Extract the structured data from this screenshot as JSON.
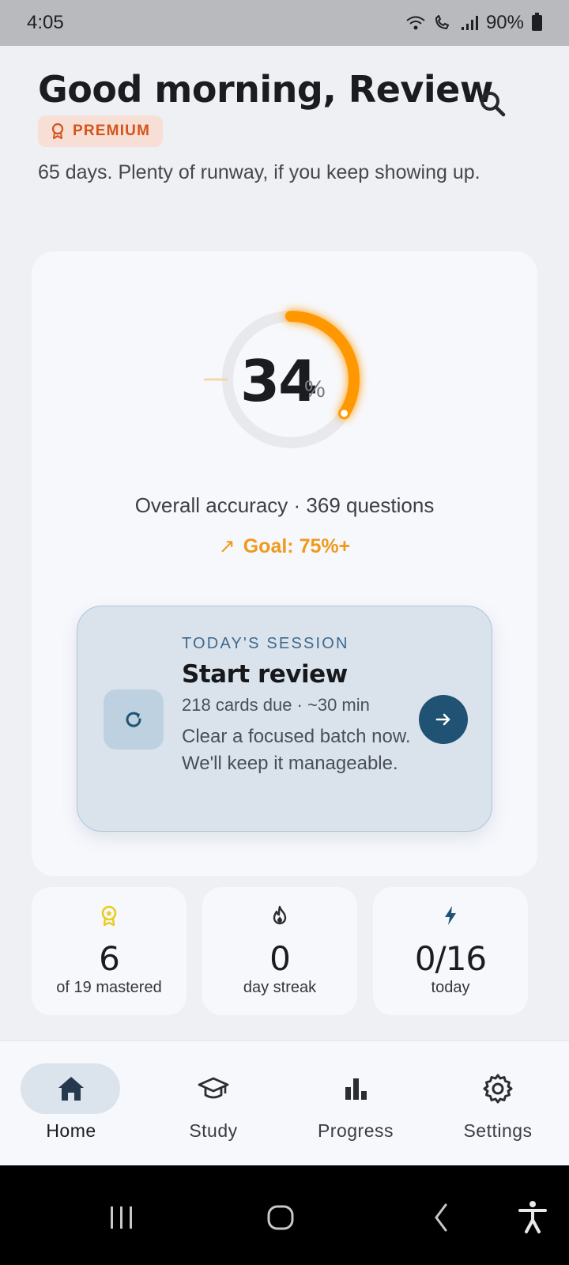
{
  "status_bar": {
    "time": "4:05",
    "battery": "90%",
    "icons": [
      "wifi-icon",
      "wifi-calling-icon",
      "signal-icon",
      "battery-icon"
    ]
  },
  "header": {
    "greeting": "Good morning, Review",
    "badge": "PREMIUM",
    "subtitle": "65 days. Plenty of runway, if you keep showing up."
  },
  "accuracy": {
    "value": "34",
    "unit": "%",
    "percent": 34,
    "summary": "Overall accuracy · 369 questions",
    "goal": "Goal: 75%+",
    "goal_icon": "trend-up-icon"
  },
  "session": {
    "kicker": "TODAY'S SESSION",
    "title": "Start review",
    "meta": "218 cards due · ~30 min",
    "description": "Clear a focused batch now. We'll keep it manageable."
  },
  "stats": [
    {
      "icon": "award-icon",
      "value": "6",
      "label": "of 19 mastered",
      "color": "#e8cc1e"
    },
    {
      "icon": "flame-icon",
      "value": "0",
      "label": "day streak",
      "color": "#2b2d33"
    },
    {
      "icon": "bolt-icon",
      "value": "0/16",
      "label": "today",
      "color": "#1f5273"
    }
  ],
  "nav": [
    {
      "label": "Home",
      "icon": "home-icon",
      "active": true
    },
    {
      "label": "Study",
      "icon": "graduation-cap-icon",
      "active": false
    },
    {
      "label": "Progress",
      "icon": "bar-chart-icon",
      "active": false
    },
    {
      "label": "Settings",
      "icon": "gear-icon",
      "active": false
    }
  ],
  "colors": {
    "accent": "#ff9800",
    "primary": "#1f5273",
    "premium": "#d4531a"
  }
}
